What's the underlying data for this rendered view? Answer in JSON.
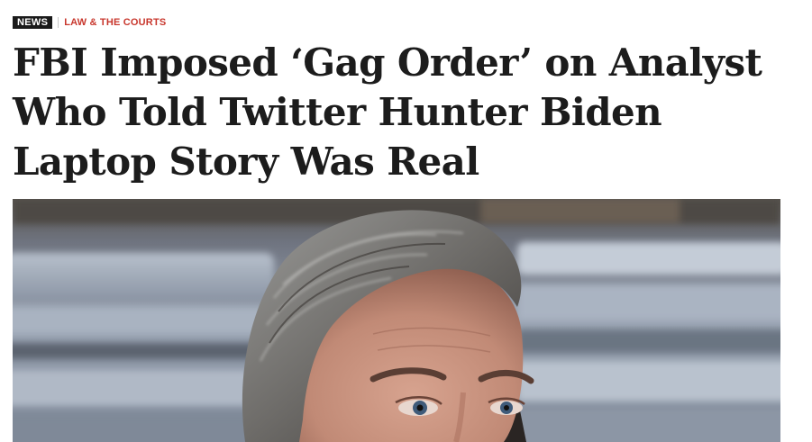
{
  "article": {
    "tag_label": "NEWS",
    "section_label": "LAW & THE COURTS",
    "headline": "FBI Imposed ‘Gag Order’ on Analyst Who Told Twitter Hunter Biden Laptop Story Was Real"
  },
  "hero_image": {
    "subject": "man with slicked-back gray hair, cropped at the eyes, in front of blurred vehicles"
  },
  "colors": {
    "section_red": "#c8372d",
    "tag_bg": "#1a1a1a",
    "headline_text": "#1c1c1c"
  }
}
